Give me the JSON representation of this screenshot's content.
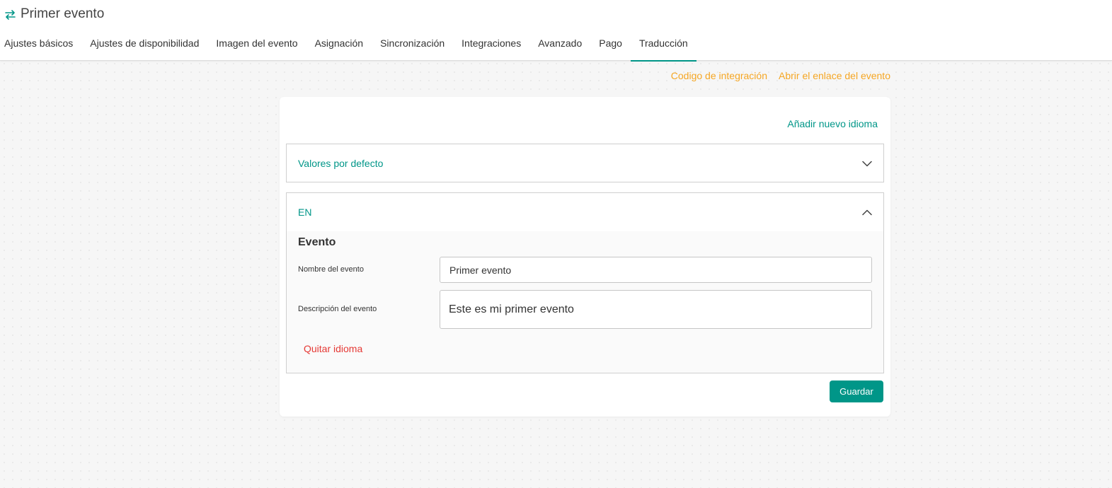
{
  "header": {
    "title": "Primer evento",
    "title_icon": "swap-arrows-icon"
  },
  "tabs": [
    {
      "label": "Ajustes básicos"
    },
    {
      "label": "Ajustes de disponibilidad"
    },
    {
      "label": "Imagen del evento"
    },
    {
      "label": "Asignación"
    },
    {
      "label": "Sincronización"
    },
    {
      "label": "Integraciones"
    },
    {
      "label": "Avanzado"
    },
    {
      "label": "Pago"
    },
    {
      "label": "Traducción",
      "active": true
    }
  ],
  "top_links": {
    "integration_code": "Codigo de integración",
    "open_event_link": "Abrir el enlace del evento"
  },
  "card": {
    "add_language": "Añadir nuevo idioma",
    "default_panel": {
      "title": "Valores por defecto",
      "expanded": false,
      "icon": "chevron-down-icon"
    },
    "en_panel": {
      "title": "EN",
      "expanded": true,
      "icon": "chevron-up-icon",
      "section_title": "Evento",
      "fields": {
        "name_label": "Nombre del evento",
        "name_value": "Primer evento",
        "description_label": "Descripción del evento",
        "description_value": "Este es mi primer evento"
      },
      "remove_language": "Quitar idioma"
    },
    "save_label": "Guardar"
  },
  "colors": {
    "accent": "#009688",
    "link_orange": "#f5a623",
    "danger": "#e53935"
  }
}
